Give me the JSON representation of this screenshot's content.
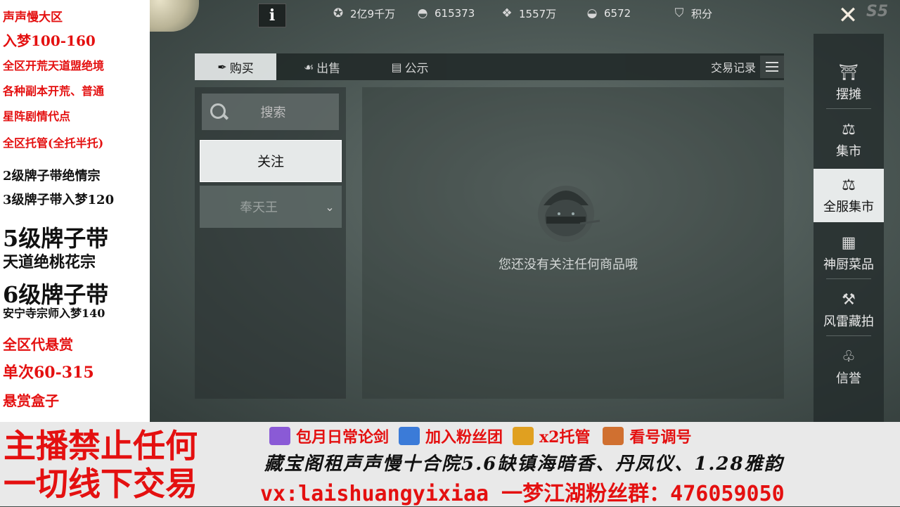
{
  "overlay_left": {
    "lines": [
      "声声慢大区",
      "入梦100-160",
      "全区开荒天道盟绝境",
      "各种副本开荒、普通",
      "星阵剧情代点",
      "全区托管(全托半托)",
      "2级牌子带绝情宗",
      "3级牌子带入梦120",
      "5级牌子带",
      "天道绝桃花宗",
      "6级牌子带",
      "安宁寺宗师入梦140",
      "全区代悬赏",
      "单次60-315",
      "悬赏盒子"
    ]
  },
  "topbar": {
    "info_label": "i",
    "currencies": [
      {
        "icon": "film-reel-icon",
        "value": "2亿9千万"
      },
      {
        "icon": "silver-ingot-icon",
        "value": "615373"
      },
      {
        "icon": "jade-icon",
        "value": "1557万"
      },
      {
        "icon": "gold-ingot-icon",
        "value": "6572"
      },
      {
        "icon": "shield-badge-icon",
        "value": "积分"
      }
    ],
    "close_label": "✕",
    "logo_text": "S5"
  },
  "tabs": [
    {
      "label": "购买",
      "icon": "feather-icon",
      "active": true
    },
    {
      "label": "出售",
      "icon": "hand-coin-icon",
      "active": false
    },
    {
      "label": "公示",
      "icon": "notice-board-icon",
      "active": false
    }
  ],
  "trade_record_label": "交易记录",
  "search": {
    "placeholder": "搜索"
  },
  "follow_button": "关注",
  "dropdown": {
    "selected": "奉天王"
  },
  "empty_message": "您还没有关注任何商品哦",
  "sidebar": [
    {
      "label": "摆摊",
      "icon": "stall-icon",
      "active": false
    },
    {
      "label": "集市",
      "icon": "scale-icon",
      "active": false
    },
    {
      "label": "全服集市",
      "icon": "scale-icon",
      "active": true
    },
    {
      "label": "神厨菜品",
      "icon": "menu-board-icon",
      "active": false
    },
    {
      "label": "风雷藏拍",
      "icon": "gavel-icon",
      "active": false
    },
    {
      "label": "信誉",
      "icon": "hand-heart-icon",
      "active": false
    }
  ],
  "banner": {
    "warning_line1": "主播禁止任何",
    "warning_line2": "一切线下交易",
    "row1": [
      "包月日常论剑",
      "加入粉丝团",
      "x2托管",
      "看号调号"
    ],
    "row2": "藏宝阁租声声慢十合院5.6缺镇海暗香、丹凤仪、1.28雅韵",
    "row3": "vx:laishuangyixiaa 一梦江湖粉丝群：476059050"
  },
  "colors": {
    "overlay_red": "#e41010",
    "active_tab": "#e4e8e8",
    "panel_dark": "#232b2a"
  }
}
